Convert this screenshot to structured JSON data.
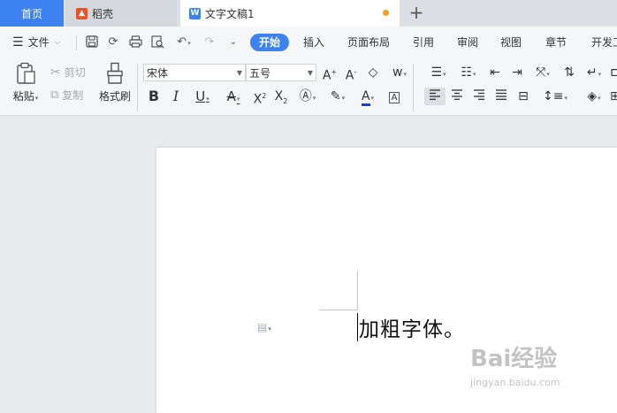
{
  "tabs": {
    "home": "首页",
    "daoke": "稻壳",
    "doc": "文字文稿1",
    "new_tab": "+"
  },
  "menu": {
    "file": "文件",
    "items": [
      "开始",
      "插入",
      "页面布局",
      "引用",
      "审阅",
      "视图",
      "章节",
      "开发工"
    ]
  },
  "ribbon": {
    "paste": "粘贴",
    "cut": "剪切",
    "copy": "复制",
    "format_painter": "格式刷",
    "font_name": "宋体",
    "font_size": "五号"
  },
  "document": {
    "text": "加粗字体。"
  },
  "watermark": {
    "brand": "Bai经验",
    "url": "jingyan.baidu.com"
  },
  "colors": {
    "accent": "#3d82f0",
    "font_color": "#1a3fd0",
    "unsaved_dot": "#f0a020"
  }
}
